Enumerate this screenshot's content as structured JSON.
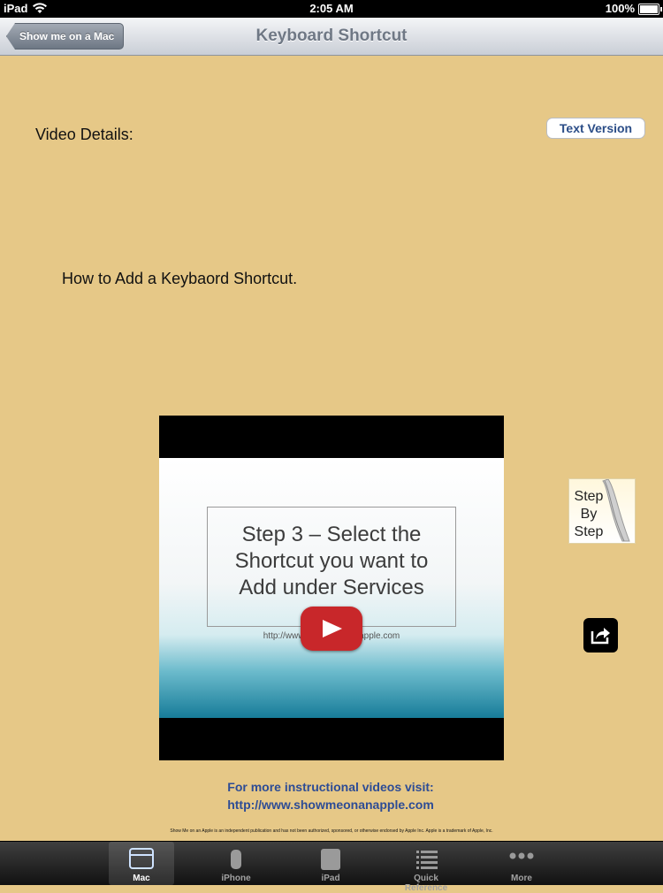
{
  "status_bar": {
    "device": "iPad",
    "time": "2:05 AM",
    "battery": "100%"
  },
  "nav": {
    "back_label": "Show me on a Mac",
    "title": "Keyboard Shortcut"
  },
  "content": {
    "video_details_label": "Video Details:",
    "text_version_button": "Text Version",
    "headline": "How to Add a Keybaord Shortcut."
  },
  "video": {
    "slide_text": "Step 3 – Select the\nShortcut you want to\nAdd under Services",
    "slide_url": "http://www.showmeonanapple.com",
    "play_color": "#c8272a"
  },
  "step_by_step": {
    "line1": "Step",
    "line2": "By",
    "line3": "Step"
  },
  "promo": {
    "line1": "For more instructional videos visit:",
    "line2": "http://www.showmeonanapple.com"
  },
  "disclaimer": "Show Me on an Apple is an independent publication and has not been authorized, sponsored, or otherwise endorsed by Apple Inc. Apple is a trademark of Apple, Inc.",
  "tabs": [
    {
      "label": "Mac",
      "icon": "mac-icon",
      "active": true
    },
    {
      "label": "iPhone",
      "icon": "iphone-icon",
      "active": false
    },
    {
      "label": "iPad",
      "icon": "ipad-icon",
      "active": false
    },
    {
      "label": "Quick Reference",
      "icon": "list-icon",
      "active": false
    },
    {
      "label": "More",
      "icon": "more-icon",
      "active": false
    }
  ]
}
